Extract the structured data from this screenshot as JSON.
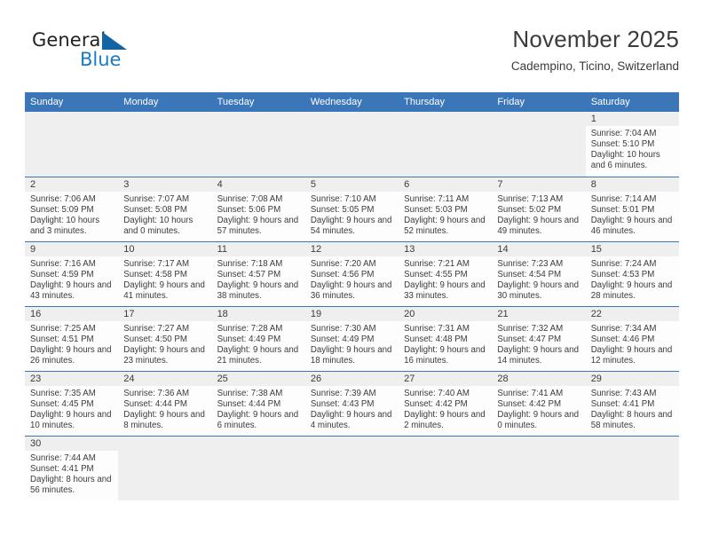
{
  "brand": {
    "name_part1": "General",
    "name_part2": "Blue",
    "color_dark": "#231f20",
    "color_blue": "#1b7ac4"
  },
  "header": {
    "title": "November 2025",
    "subtitle": "Cadempino, Ticino, Switzerland"
  },
  "theme": {
    "header_blue": "#3b77b8",
    "row_divider_blue": "#3b77b8",
    "day_band_gray": "#efefef",
    "cell_white": "#fdfdfd",
    "text": "#3b3b3b"
  },
  "weekdays": [
    "Sunday",
    "Monday",
    "Tuesday",
    "Wednesday",
    "Thursday",
    "Friday",
    "Saturday"
  ],
  "labels": {
    "sunrise_prefix": "Sunrise: ",
    "sunset_prefix": "Sunset: ",
    "daylight_prefix": "Daylight: "
  },
  "weeks": [
    [
      {
        "empty": true
      },
      {
        "empty": true
      },
      {
        "empty": true
      },
      {
        "empty": true
      },
      {
        "empty": true
      },
      {
        "empty": true
      },
      {
        "day": "1",
        "sunrise": "Sunrise: 7:04 AM",
        "sunset": "Sunset: 5:10 PM",
        "daylight": "Daylight: 10 hours and 6 minutes."
      }
    ],
    [
      {
        "day": "2",
        "sunrise": "Sunrise: 7:06 AM",
        "sunset": "Sunset: 5:09 PM",
        "daylight": "Daylight: 10 hours and 3 minutes."
      },
      {
        "day": "3",
        "sunrise": "Sunrise: 7:07 AM",
        "sunset": "Sunset: 5:08 PM",
        "daylight": "Daylight: 10 hours and 0 minutes."
      },
      {
        "day": "4",
        "sunrise": "Sunrise: 7:08 AM",
        "sunset": "Sunset: 5:06 PM",
        "daylight": "Daylight: 9 hours and 57 minutes."
      },
      {
        "day": "5",
        "sunrise": "Sunrise: 7:10 AM",
        "sunset": "Sunset: 5:05 PM",
        "daylight": "Daylight: 9 hours and 54 minutes."
      },
      {
        "day": "6",
        "sunrise": "Sunrise: 7:11 AM",
        "sunset": "Sunset: 5:03 PM",
        "daylight": "Daylight: 9 hours and 52 minutes."
      },
      {
        "day": "7",
        "sunrise": "Sunrise: 7:13 AM",
        "sunset": "Sunset: 5:02 PM",
        "daylight": "Daylight: 9 hours and 49 minutes."
      },
      {
        "day": "8",
        "sunrise": "Sunrise: 7:14 AM",
        "sunset": "Sunset: 5:01 PM",
        "daylight": "Daylight: 9 hours and 46 minutes."
      }
    ],
    [
      {
        "day": "9",
        "sunrise": "Sunrise: 7:16 AM",
        "sunset": "Sunset: 4:59 PM",
        "daylight": "Daylight: 9 hours and 43 minutes."
      },
      {
        "day": "10",
        "sunrise": "Sunrise: 7:17 AM",
        "sunset": "Sunset: 4:58 PM",
        "daylight": "Daylight: 9 hours and 41 minutes."
      },
      {
        "day": "11",
        "sunrise": "Sunrise: 7:18 AM",
        "sunset": "Sunset: 4:57 PM",
        "daylight": "Daylight: 9 hours and 38 minutes."
      },
      {
        "day": "12",
        "sunrise": "Sunrise: 7:20 AM",
        "sunset": "Sunset: 4:56 PM",
        "daylight": "Daylight: 9 hours and 36 minutes."
      },
      {
        "day": "13",
        "sunrise": "Sunrise: 7:21 AM",
        "sunset": "Sunset: 4:55 PM",
        "daylight": "Daylight: 9 hours and 33 minutes."
      },
      {
        "day": "14",
        "sunrise": "Sunrise: 7:23 AM",
        "sunset": "Sunset: 4:54 PM",
        "daylight": "Daylight: 9 hours and 30 minutes."
      },
      {
        "day": "15",
        "sunrise": "Sunrise: 7:24 AM",
        "sunset": "Sunset: 4:53 PM",
        "daylight": "Daylight: 9 hours and 28 minutes."
      }
    ],
    [
      {
        "day": "16",
        "sunrise": "Sunrise: 7:25 AM",
        "sunset": "Sunset: 4:51 PM",
        "daylight": "Daylight: 9 hours and 26 minutes."
      },
      {
        "day": "17",
        "sunrise": "Sunrise: 7:27 AM",
        "sunset": "Sunset: 4:50 PM",
        "daylight": "Daylight: 9 hours and 23 minutes."
      },
      {
        "day": "18",
        "sunrise": "Sunrise: 7:28 AM",
        "sunset": "Sunset: 4:49 PM",
        "daylight": "Daylight: 9 hours and 21 minutes."
      },
      {
        "day": "19",
        "sunrise": "Sunrise: 7:30 AM",
        "sunset": "Sunset: 4:49 PM",
        "daylight": "Daylight: 9 hours and 18 minutes."
      },
      {
        "day": "20",
        "sunrise": "Sunrise: 7:31 AM",
        "sunset": "Sunset: 4:48 PM",
        "daylight": "Daylight: 9 hours and 16 minutes."
      },
      {
        "day": "21",
        "sunrise": "Sunrise: 7:32 AM",
        "sunset": "Sunset: 4:47 PM",
        "daylight": "Daylight: 9 hours and 14 minutes."
      },
      {
        "day": "22",
        "sunrise": "Sunrise: 7:34 AM",
        "sunset": "Sunset: 4:46 PM",
        "daylight": "Daylight: 9 hours and 12 minutes."
      }
    ],
    [
      {
        "day": "23",
        "sunrise": "Sunrise: 7:35 AM",
        "sunset": "Sunset: 4:45 PM",
        "daylight": "Daylight: 9 hours and 10 minutes."
      },
      {
        "day": "24",
        "sunrise": "Sunrise: 7:36 AM",
        "sunset": "Sunset: 4:44 PM",
        "daylight": "Daylight: 9 hours and 8 minutes."
      },
      {
        "day": "25",
        "sunrise": "Sunrise: 7:38 AM",
        "sunset": "Sunset: 4:44 PM",
        "daylight": "Daylight: 9 hours and 6 minutes."
      },
      {
        "day": "26",
        "sunrise": "Sunrise: 7:39 AM",
        "sunset": "Sunset: 4:43 PM",
        "daylight": "Daylight: 9 hours and 4 minutes."
      },
      {
        "day": "27",
        "sunrise": "Sunrise: 7:40 AM",
        "sunset": "Sunset: 4:42 PM",
        "daylight": "Daylight: 9 hours and 2 minutes."
      },
      {
        "day": "28",
        "sunrise": "Sunrise: 7:41 AM",
        "sunset": "Sunset: 4:42 PM",
        "daylight": "Daylight: 9 hours and 0 minutes."
      },
      {
        "day": "29",
        "sunrise": "Sunrise: 7:43 AM",
        "sunset": "Sunset: 4:41 PM",
        "daylight": "Daylight: 8 hours and 58 minutes."
      }
    ],
    [
      {
        "day": "30",
        "sunrise": "Sunrise: 7:44 AM",
        "sunset": "Sunset: 4:41 PM",
        "daylight": "Daylight: 8 hours and 56 minutes."
      },
      {
        "empty": true
      },
      {
        "empty": true
      },
      {
        "empty": true
      },
      {
        "empty": true
      },
      {
        "empty": true
      },
      {
        "empty": true
      }
    ]
  ]
}
